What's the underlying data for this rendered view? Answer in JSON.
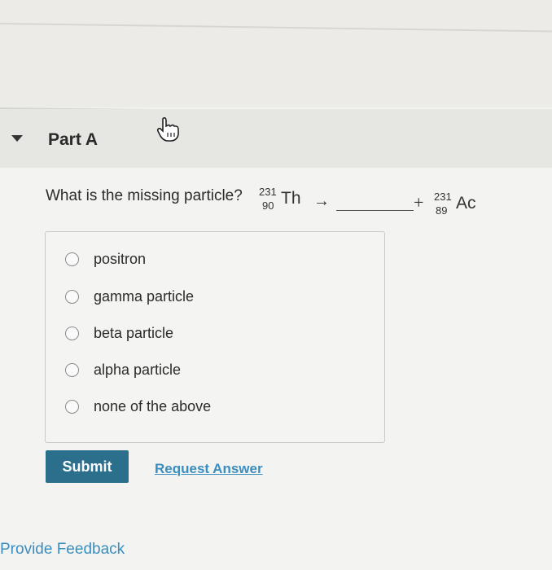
{
  "section": {
    "title": "Part A"
  },
  "question": {
    "prompt": "What is the missing particle?",
    "reactant": {
      "mass": "231",
      "atomic": "90",
      "symbol": "Th"
    },
    "arrow": "→",
    "plus": "+",
    "product": {
      "mass": "231",
      "atomic": "89",
      "symbol": "Ac"
    }
  },
  "options": [
    {
      "label": "positron"
    },
    {
      "label": "gamma particle"
    },
    {
      "label": "beta particle"
    },
    {
      "label": "alpha particle"
    },
    {
      "label": "none of the above"
    }
  ],
  "actions": {
    "submit_label": "Submit",
    "request_label": "Request Answer"
  },
  "footer": {
    "feedback_label": "Provide Feedback"
  },
  "colors": {
    "accent": "#2c6f8c",
    "link": "#3a8ec0"
  },
  "icons": {
    "cursor": "hand-pointer-icon",
    "collapse": "caret-down-icon"
  }
}
